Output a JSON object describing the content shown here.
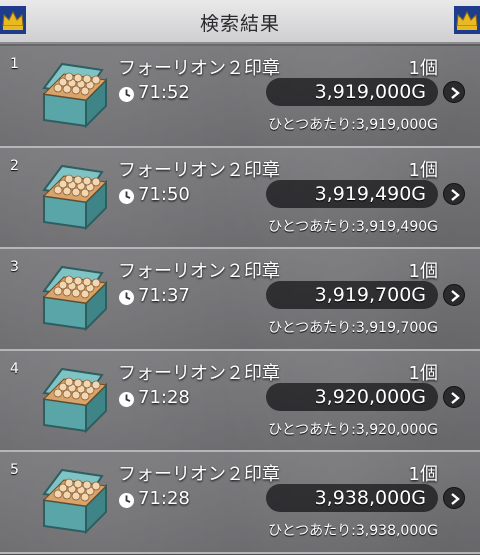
{
  "header": {
    "title": "検索結果"
  },
  "results": [
    {
      "index": "1",
      "name": "フォーリオン２印章",
      "quantity": "1個",
      "time_left": "71:52",
      "price": "3,919,000G",
      "unit_price": "ひとつあたり:3,919,000G"
    },
    {
      "index": "2",
      "name": "フォーリオン２印章",
      "quantity": "1個",
      "time_left": "71:50",
      "price": "3,919,490G",
      "unit_price": "ひとつあたり:3,919,490G"
    },
    {
      "index": "3",
      "name": "フォーリオン２印章",
      "quantity": "1個",
      "time_left": "71:37",
      "price": "3,919,700G",
      "unit_price": "ひとつあたり:3,919,700G"
    },
    {
      "index": "4",
      "name": "フォーリオン２印章",
      "quantity": "1個",
      "time_left": "71:28",
      "price": "3,920,000G",
      "unit_price": "ひとつあたり:3,920,000G"
    },
    {
      "index": "5",
      "name": "フォーリオン２印章",
      "quantity": "1個",
      "time_left": "71:28",
      "price": "3,938,000G",
      "unit_price": "ひとつあたり:3,938,000G"
    }
  ],
  "icons": {
    "item": "treasure-box-icon",
    "timer": "clock-icon",
    "detail": "chevron-right-icon",
    "decoration": "crown-icon"
  },
  "colors": {
    "header_bg": "#dcdcde",
    "row_bg": "#747477",
    "pill_bg": "#1f1f21",
    "crown_gold": "#e8b923",
    "crown_blue": "#1e3c8c",
    "box_teal": "#6fb6b8"
  }
}
